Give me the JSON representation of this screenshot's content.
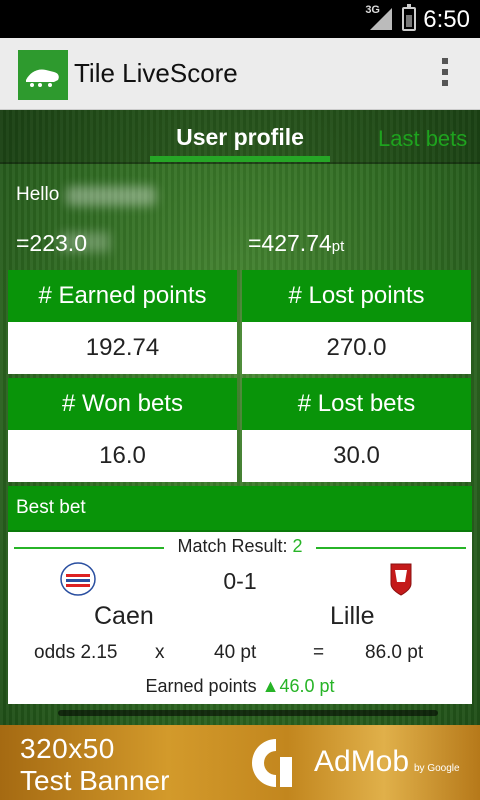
{
  "status_bar": {
    "network": "3G",
    "time": "6:50"
  },
  "app": {
    "title": "Tile LiveScore",
    "accent": "#099409"
  },
  "tabs": {
    "active": "User profile",
    "inactive": "Last bets"
  },
  "profile": {
    "hello": "Hello",
    "balance_left": "=223.0",
    "balance_right": "=427.74",
    "balance_right_unit": "pt"
  },
  "stats": {
    "earned_points": {
      "label": "# Earned points",
      "value": "192.74"
    },
    "lost_points": {
      "label": "# Lost points",
      "value": "270.0"
    },
    "won_bets": {
      "label": "# Won bets",
      "value": "16.0"
    },
    "lost_bets": {
      "label": "# Lost bets",
      "value": "30.0"
    }
  },
  "best_bet": {
    "header": "Best bet",
    "match_result_label": "Match Result:",
    "match_result_value": "2",
    "score": "0-1",
    "home_team": "Caen",
    "away_team": "Lille",
    "odds": "odds 2.15",
    "times": "x",
    "stake": "40 pt",
    "equals": "=",
    "payout": "86.0 pt",
    "earned_label": "Earned points",
    "earned_arrow": "▲",
    "earned_value": "46.0 pt"
  },
  "ad": {
    "line1": "320x50",
    "line2": "Test Banner",
    "brand": "AdMob",
    "by": "by Google"
  }
}
